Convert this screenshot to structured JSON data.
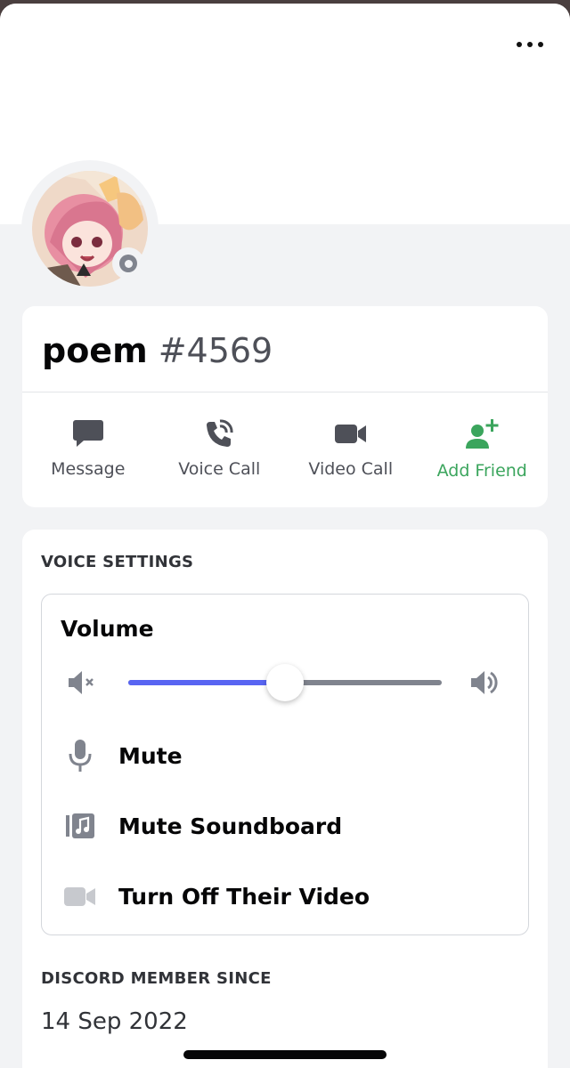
{
  "profile": {
    "username": "poem",
    "discriminator": "#4569",
    "status": "offline"
  },
  "actions": [
    {
      "label": "Message",
      "icon": "message-icon"
    },
    {
      "label": "Voice Call",
      "icon": "phone-call-icon"
    },
    {
      "label": "Video Call",
      "icon": "video-camera-icon"
    },
    {
      "label": "Add Friend",
      "icon": "add-friend-icon"
    }
  ],
  "voice_settings": {
    "title": "VOICE SETTINGS",
    "volume_label": "Volume",
    "volume_level": 0.5,
    "options": [
      {
        "label": "Mute",
        "icon": "microphone-icon"
      },
      {
        "label": "Mute Soundboard",
        "icon": "soundboard-icon"
      },
      {
        "label": "Turn Off Their Video",
        "icon": "video-off-icon"
      }
    ]
  },
  "member_since": {
    "title": "DISCORD MEMBER SINCE",
    "date": "14 Sep 2022"
  },
  "colors": {
    "accent": "#5865f2",
    "green": "#3ba55d",
    "status_offline": "#80848e"
  }
}
